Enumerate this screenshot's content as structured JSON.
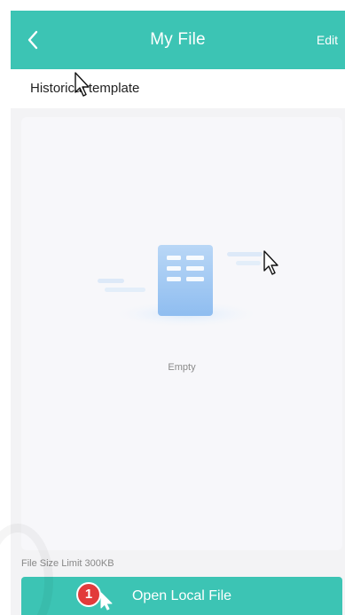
{
  "navbar": {
    "title": "My File",
    "edit_label": "Edit",
    "back_icon": "chevron-left-icon"
  },
  "section": {
    "title": "Historical template"
  },
  "empty_state": {
    "text": "Empty",
    "icon": "document-icon"
  },
  "footer": {
    "file_limit": "File Size Limit 300KB",
    "open_button_label": "Open Local File",
    "step_badge": "1"
  },
  "colors": {
    "accent": "#3cc4b4",
    "badge": "#e23b3b",
    "background": "#f3f3f5"
  }
}
